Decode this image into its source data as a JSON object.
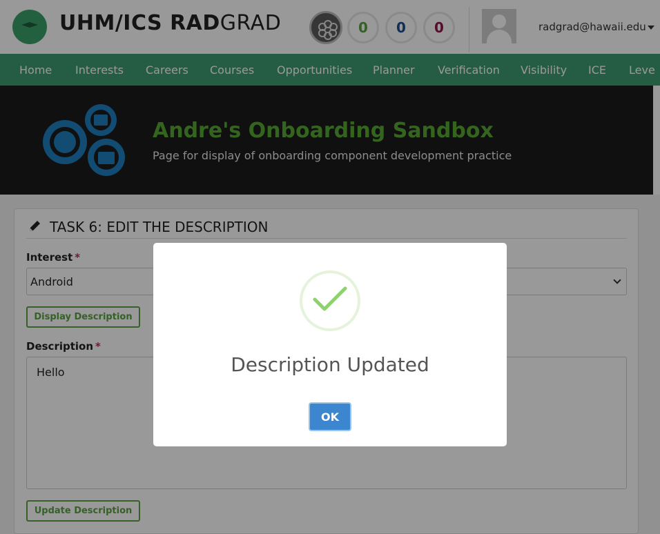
{
  "header": {
    "brand_bold": "UHM/ICS RAD",
    "brand_light": "GRAD",
    "ice": {
      "i": "0",
      "c": "0",
      "e": "0"
    },
    "user_email": "radgrad@hawaii.edu"
  },
  "nav": {
    "items": [
      "Home",
      "Interests",
      "Careers",
      "Courses",
      "Opportunities",
      "Planner",
      "Verification",
      "Visibility",
      "ICE",
      "Leve"
    ]
  },
  "banner": {
    "title": "Andre's Onboarding Sandbox",
    "subtitle": "Page for display of onboarding component development practice"
  },
  "task": {
    "title": "TASK 6: EDIT THE DESCRIPTION",
    "interest_label": "Interest",
    "interest_value": "Android",
    "display_button": "Display Description",
    "description_label": "Description",
    "description_value": "Hello",
    "update_button": "Update Description",
    "required_mark": "*"
  },
  "modal": {
    "title": "Description Updated",
    "ok_label": "OK"
  },
  "colors": {
    "nav_green": "#3e9c72",
    "banner_title_green": "#58a832",
    "button_green": "#5aa142",
    "ok_blue": "#3b86cf"
  },
  "icons": [
    "radgrad-logo-icon",
    "level-badge-icon",
    "user-avatar-icon",
    "caret-down-icon",
    "gears-logo-icon",
    "pencil-icon",
    "chevron-down-icon",
    "checkmark-icon"
  ]
}
